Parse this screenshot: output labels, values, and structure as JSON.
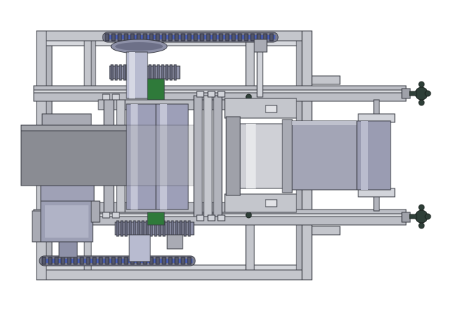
{
  "drawing": {
    "view": "top view",
    "colors": {
      "background": "#ffffff",
      "frame": "#c4c6cc",
      "frame_dark": "#8c8f98",
      "steel": "#a9abb4",
      "steel_light": "#d2d4da",
      "shaft": "#8e91a8",
      "shaft_light": "#b8bbd0",
      "belt": "#8a8c93",
      "belt_light": "#a3a5ab",
      "chain": "#55586a",
      "chain_blue": "#4a5fb4",
      "gear_green": "#2f7a3a",
      "knob": "#2e3f38",
      "outline": "#3a3c44"
    },
    "parts": [
      "outer-frame",
      "top-chain",
      "bottom-chain",
      "top-gear-set",
      "bottom-gear-set",
      "roller-assembly",
      "feed-belt-left",
      "output-belt-right",
      "center-roller",
      "right-pulley",
      "motor-gearbox",
      "adjustment-knobs"
    ]
  }
}
